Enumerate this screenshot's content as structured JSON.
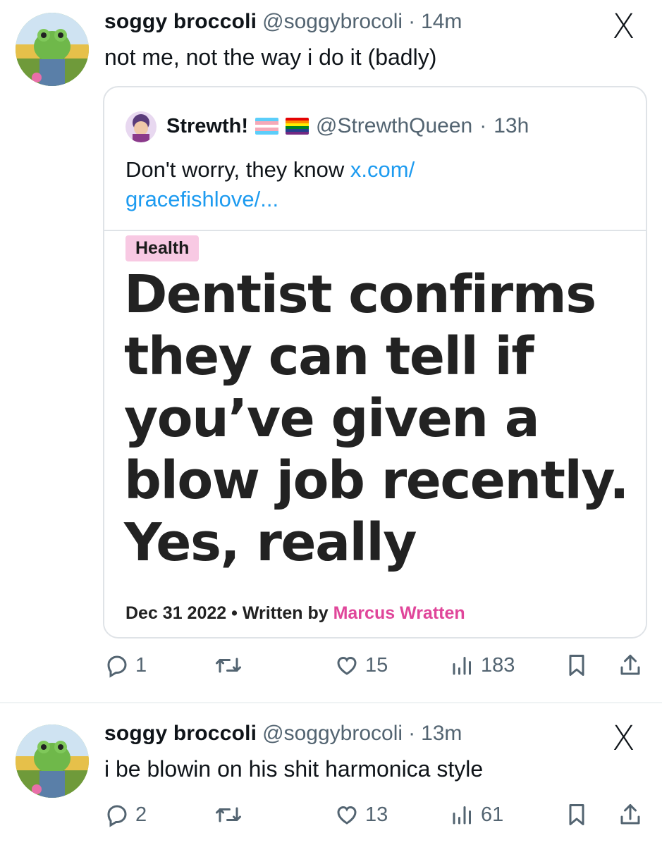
{
  "tweets": [
    {
      "author_name": "soggy broccoli",
      "handle": "@soggybrocoli",
      "separator": "·",
      "time": "14m",
      "text": "not me, not the way i do it (badly)",
      "actions": {
        "replies": "1",
        "likes": "15",
        "views": "183"
      }
    },
    {
      "author_name": "soggy broccoli",
      "handle": "@soggybrocoli",
      "separator": "·",
      "time": "13m",
      "text": "i be blowin on his shit harmonica style",
      "actions": {
        "replies": "2",
        "likes": "13",
        "views": "61"
      }
    }
  ],
  "quote": {
    "author_name": "Strewth!",
    "handle": "@StrewthQueen",
    "separator": "·",
    "time": "13h",
    "text_before_link": "Don't worry, they know ",
    "link_line1": "x.com/",
    "link_line2": "gracefishlove/...",
    "article": {
      "tag": "Health",
      "headline_lines": [
        "Dentist confirms",
        "they can tell if",
        "you’ve given a",
        "blow job recently.",
        "Yes, really"
      ],
      "date": "Dec 31 2022",
      "bullet": "•",
      "written_by": "Written by",
      "author": "Marcus Wratten"
    }
  },
  "brand_logo": "X",
  "icons": [
    "reply-icon",
    "retweet-icon",
    "like-icon",
    "views-icon",
    "bookmark-icon",
    "share-icon"
  ],
  "colors": {
    "link": "#1d9bf0",
    "secondary_text": "#536471",
    "tag_bg": "#f8c9e3",
    "author_pink": "#e0469a"
  }
}
